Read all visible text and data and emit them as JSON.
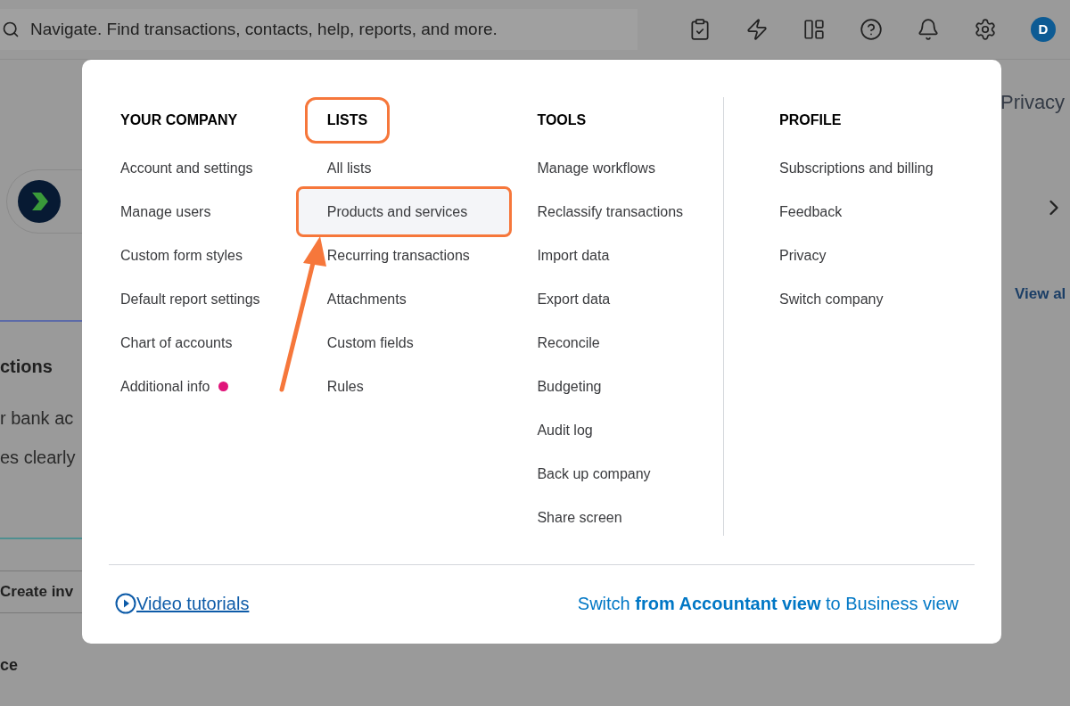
{
  "top_bar": {
    "search": {
      "placeholder": "Navigate. Find transactions, contacts, help, reports, and more."
    },
    "avatar": "D"
  },
  "background": {
    "left": {
      "heading": "ctions",
      "lines": [
        "r bank ac",
        "es clearly"
      ],
      "button": "Create inv",
      "section": "ce"
    },
    "right": {
      "link": "Privacy",
      "view_all": "View al"
    }
  },
  "menu": {
    "columns": [
      {
        "heading": "YOUR COMPANY",
        "highlighted": false,
        "items": [
          {
            "label": "Account and settings",
            "highlighted": false,
            "dot": false
          },
          {
            "label": "Manage users",
            "highlighted": false,
            "dot": false
          },
          {
            "label": "Custom form styles",
            "highlighted": false,
            "dot": false
          },
          {
            "label": "Default report settings",
            "highlighted": false,
            "dot": false
          },
          {
            "label": "Chart of accounts",
            "highlighted": false,
            "dot": false
          },
          {
            "label": "Additional info",
            "highlighted": false,
            "dot": true
          }
        ]
      },
      {
        "heading": "LISTS",
        "highlighted": true,
        "items": [
          {
            "label": "All lists",
            "highlighted": false,
            "dot": false
          },
          {
            "label": "Products and services",
            "highlighted": true,
            "dot": false
          },
          {
            "label": "Recurring transactions",
            "highlighted": false,
            "dot": false
          },
          {
            "label": "Attachments",
            "highlighted": false,
            "dot": false
          },
          {
            "label": "Custom fields",
            "highlighted": false,
            "dot": false
          },
          {
            "label": "Rules",
            "highlighted": false,
            "dot": false
          }
        ]
      },
      {
        "heading": "TOOLS",
        "highlighted": false,
        "items": [
          {
            "label": "Manage workflows",
            "highlighted": false,
            "dot": false
          },
          {
            "label": "Reclassify transactions",
            "highlighted": false,
            "dot": false
          },
          {
            "label": "Import data",
            "highlighted": false,
            "dot": false
          },
          {
            "label": "Export data",
            "highlighted": false,
            "dot": false
          },
          {
            "label": "Reconcile",
            "highlighted": false,
            "dot": false
          },
          {
            "label": "Budgeting",
            "highlighted": false,
            "dot": false
          },
          {
            "label": "Audit log",
            "highlighted": false,
            "dot": false
          },
          {
            "label": "Back up company",
            "highlighted": false,
            "dot": false
          },
          {
            "label": "Share screen",
            "highlighted": false,
            "dot": false
          }
        ]
      },
      {
        "heading": "PROFILE",
        "highlighted": false,
        "items": [
          {
            "label": "Subscriptions and billing",
            "highlighted": false,
            "dot": false
          },
          {
            "label": "Feedback",
            "highlighted": false,
            "dot": false
          },
          {
            "label": "Privacy",
            "highlighted": false,
            "dot": false
          },
          {
            "label": "Switch company",
            "highlighted": false,
            "dot": false
          }
        ]
      }
    ],
    "footer": {
      "video_link": "Video tutorials",
      "switch_view": "Switch **from Accountant view** to Business view"
    }
  }
}
